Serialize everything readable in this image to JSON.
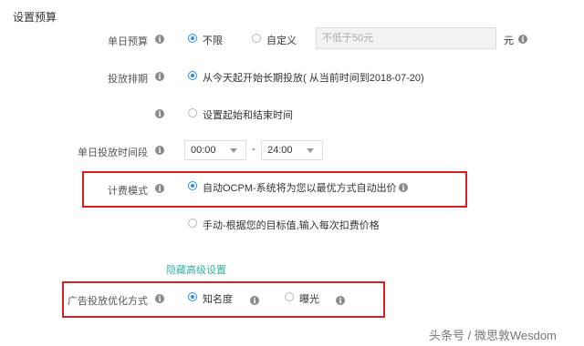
{
  "section_title": "设置预算",
  "daily_budget": {
    "label": "单日预算",
    "option_unlimited": "不限",
    "option_custom": "自定义",
    "input_placeholder": "不低于50元",
    "unit": "元"
  },
  "schedule": {
    "label": "投放排期",
    "option_long_term": "从今天起开始长期投放( 从当前时间到2018-07-20)",
    "option_range": "设置起始和结束时间"
  },
  "daily_time": {
    "label": "单日投放时间段",
    "start": "00:00",
    "separator": "-",
    "end": "24:00"
  },
  "billing": {
    "label": "计费模式",
    "option_auto": "自动OCPM-系统将为您以最优方式自动出价",
    "option_manual": "手动-根据您的目标值,输入每次扣费价格"
  },
  "advanced_link": "隐藏高级设置",
  "optimization": {
    "label": "广告投放优化方式",
    "option_awareness": "知名度",
    "option_exposure": "曝光"
  },
  "watermark": "头条号 / 微思敦Wesdom",
  "colors": {
    "accent": "#2d8cf0",
    "link": "#33b3a0",
    "highlight_box": "#d92020"
  }
}
